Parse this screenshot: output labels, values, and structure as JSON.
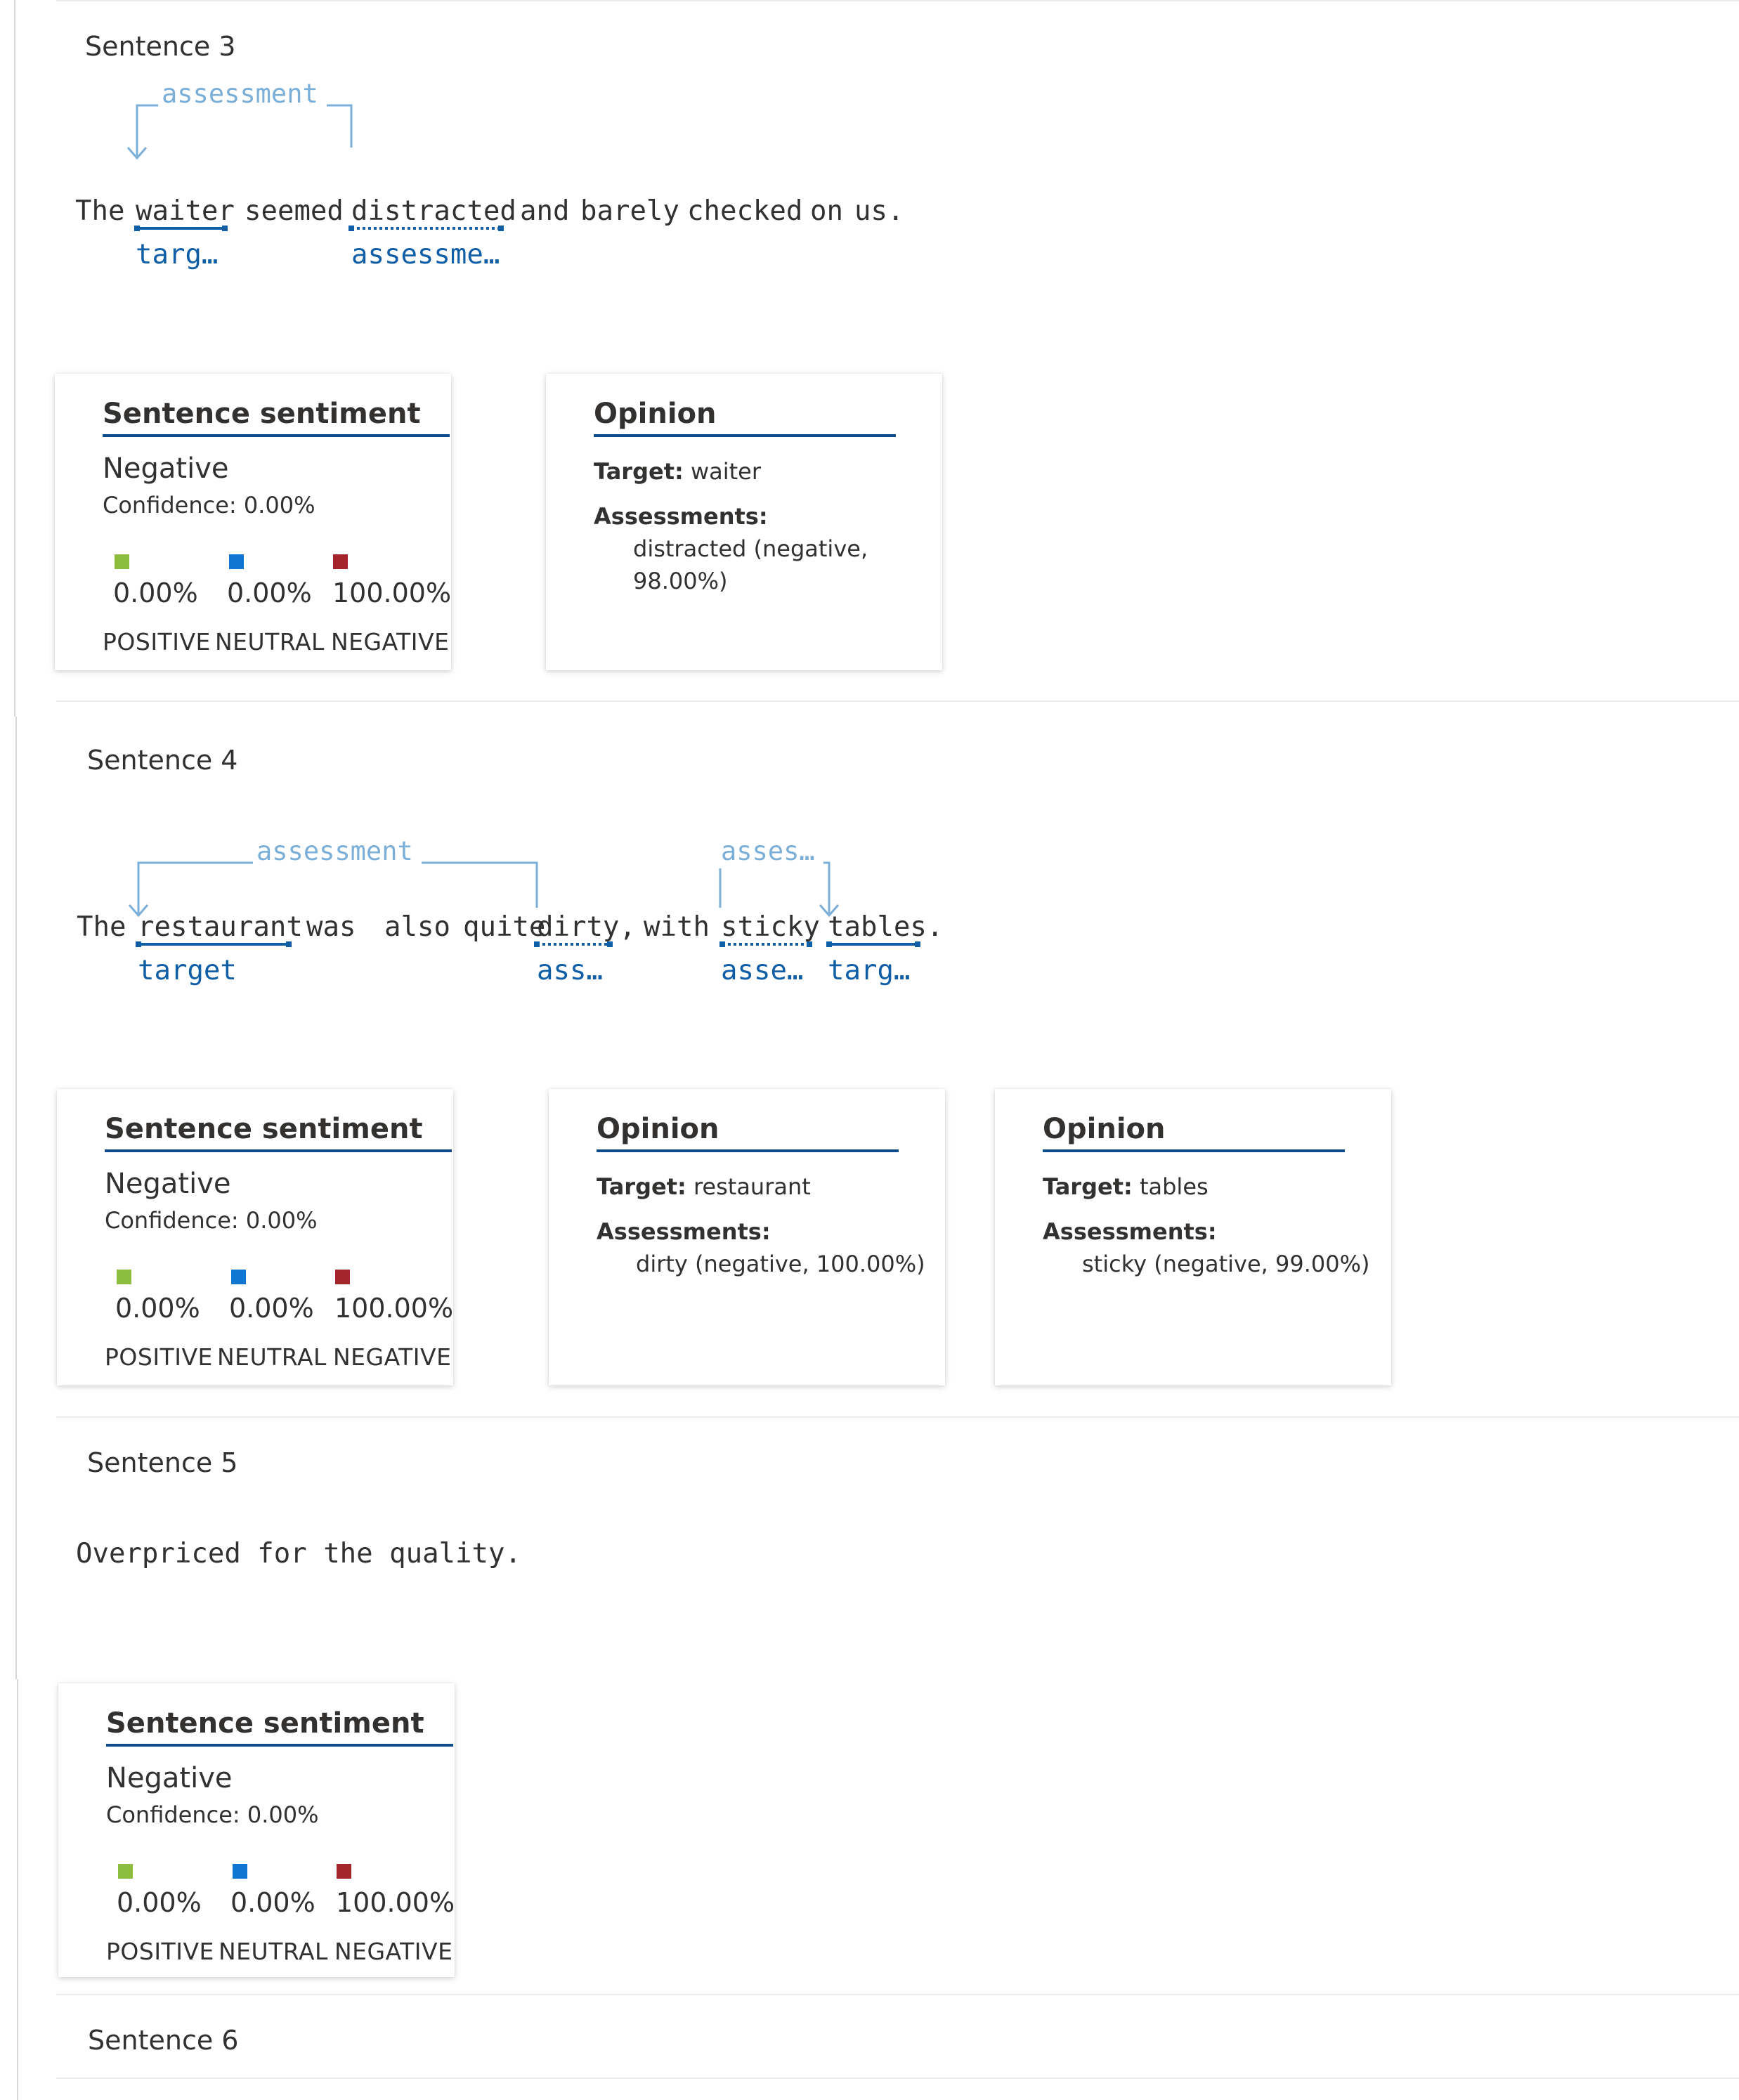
{
  "colors": {
    "positive": "#8cbd3c",
    "neutral": "#0f77d1",
    "negative": "#a4262c",
    "link_blue": "#0f5ea6",
    "arc_blue": "#7bafd8"
  },
  "sentences": [
    {
      "title": "Sentence 3",
      "words": [
        "The",
        "waiter",
        "seemed",
        "distracted",
        "and",
        "barely",
        "checked",
        "on",
        "us."
      ],
      "tags": [
        {
          "word": "waiter",
          "label": "targ…",
          "kind": "target"
        },
        {
          "word": "distracted",
          "label": "assessme…",
          "kind": "assessment"
        }
      ],
      "relations": [
        {
          "label": "assessment"
        }
      ],
      "sentiment": {
        "card_title": "Sentence sentiment",
        "label": "Negative",
        "confidence": "Confidence: 0.00%",
        "scores": [
          {
            "name": "POSITIVE",
            "value": "0.00%",
            "color_key": "positive"
          },
          {
            "name": "NEUTRAL",
            "value": "0.00%",
            "color_key": "neutral"
          },
          {
            "name": "NEGATIVE",
            "value": "100.00%",
            "color_key": "negative"
          }
        ]
      },
      "opinions": [
        {
          "card_title": "Opinion",
          "target_label": "Target:",
          "target": "waiter",
          "assessments_label": "Assessments:",
          "assessments": "distracted (negative, 98.00%)"
        }
      ]
    },
    {
      "title": "Sentence 4",
      "words": [
        "The",
        "restaurant",
        "was",
        "also",
        "quite",
        "dirty,",
        "with",
        "sticky",
        "tables."
      ],
      "tags": [
        {
          "word": "restaurant",
          "label": "target",
          "kind": "target"
        },
        {
          "word": "dirty",
          "label": "ass…",
          "kind": "assessment"
        },
        {
          "word": "sticky",
          "label": "asse…",
          "kind": "assessment"
        },
        {
          "word": "tables",
          "label": "targ…",
          "kind": "target"
        }
      ],
      "relations": [
        {
          "label": "assessment"
        },
        {
          "label": "asses…"
        }
      ],
      "sentiment": {
        "card_title": "Sentence sentiment",
        "label": "Negative",
        "confidence": "Confidence: 0.00%",
        "scores": [
          {
            "name": "POSITIVE",
            "value": "0.00%",
            "color_key": "positive"
          },
          {
            "name": "NEUTRAL",
            "value": "0.00%",
            "color_key": "neutral"
          },
          {
            "name": "NEGATIVE",
            "value": "100.00%",
            "color_key": "negative"
          }
        ]
      },
      "opinions": [
        {
          "card_title": "Opinion",
          "target_label": "Target:",
          "target": "restaurant",
          "assessments_label": "Assessments:",
          "assessments": "dirty (negative, 100.00%)"
        },
        {
          "card_title": "Opinion",
          "target_label": "Target:",
          "target": "tables",
          "assessments_label": "Assessments:",
          "assessments": "sticky (negative, 99.00%)"
        }
      ]
    },
    {
      "title": "Sentence 5",
      "text": "Overpriced for the quality.",
      "sentiment": {
        "card_title": "Sentence sentiment",
        "label": "Negative",
        "confidence": "Confidence: 0.00%",
        "scores": [
          {
            "name": "POSITIVE",
            "value": "0.00%",
            "color_key": "positive"
          },
          {
            "name": "NEUTRAL",
            "value": "0.00%",
            "color_key": "neutral"
          },
          {
            "name": "NEGATIVE",
            "value": "100.00%",
            "color_key": "negative"
          }
        ]
      }
    },
    {
      "title": "Sentence 6"
    }
  ]
}
